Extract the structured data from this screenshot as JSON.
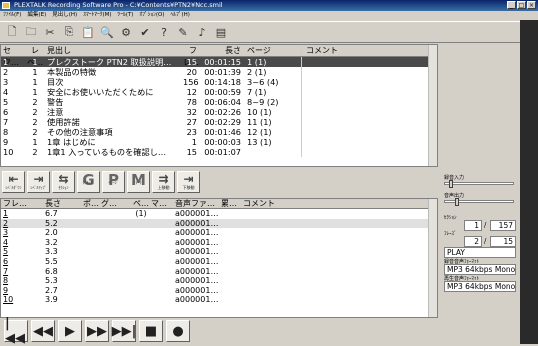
{
  "window": {
    "title": "PLEXTALK Recording Software Pro - C:¥Contents¥PTN2¥Ncc.smil"
  },
  "menu": [
    "ﾌｧｲﾙ(F)",
    "編集(E)",
    "見出し(H)",
    "ｽﾏｰﾄﾏｰｸ(M)",
    "ﾂｰﾙ(T)",
    "ｵﾌﾟｼｮﾝ(O)",
    "ﾍﾙﾌﾟ(H)"
  ],
  "toolbar_icons": [
    "new-file-icon",
    "open-folder-icon",
    "cut-icon",
    "copy-icon",
    "paste-icon",
    "search-icon",
    "properties-icon",
    "check-icon",
    "help-icon",
    "tool-icon",
    "sound-icon",
    "document-icon"
  ],
  "upper_headers": {
    "section": "セク…",
    "level": "レベ…",
    "heading": "見出し",
    "file": "フレ…",
    "length": "長さ",
    "page": "ページ",
    "comment": "コメント"
  },
  "upper_rows": [
    {
      "section": "1",
      "level": "1",
      "heading": "プレクストーク PTN2 取扱説明…",
      "file": "15",
      "length": "00:01:15",
      "page": "1 (1)"
    },
    {
      "section": "2",
      "level": "1",
      "heading": "本製品の特徴",
      "file": "20",
      "length": "00:01:39",
      "page": "2 (1)"
    },
    {
      "section": "3",
      "level": "1",
      "heading": "目次",
      "file": "156",
      "length": "00:14:18",
      "page": "3~6 (4)"
    },
    {
      "section": "4",
      "level": "1",
      "heading": "安全にお使いいただくために",
      "file": "12",
      "length": "00:00:59",
      "page": "7 (1)"
    },
    {
      "section": "5",
      "level": "2",
      "heading": "警告",
      "file": "78",
      "length": "00:06:04",
      "page": "8~9 (2)"
    },
    {
      "section": "6",
      "level": "2",
      "heading": "注意",
      "file": "32",
      "length": "00:02:26",
      "page": "10 (1)"
    },
    {
      "section": "7",
      "level": "2",
      "heading": "使用許諾",
      "file": "27",
      "length": "00:02:29",
      "page": "11 (1)"
    },
    {
      "section": "8",
      "level": "2",
      "heading": "その他の注意事項",
      "file": "23",
      "length": "00:01:46",
      "page": "12 (1)"
    },
    {
      "section": "9",
      "level": "1",
      "heading": "1章 はじめに",
      "file": "1",
      "length": "00:00:03",
      "page": "13 (1)"
    },
    {
      "section": "10",
      "level": "2",
      "heading": "1章1 入っているものを確認し…",
      "file": "15",
      "length": "00:01:07",
      "page": ""
    }
  ],
  "nav_buttons": [
    {
      "name": "prev-level-button",
      "symbol": "⇤",
      "label": "ﾚﾍﾞﾙﾀﾞｳﾝ"
    },
    {
      "name": "next-level-button",
      "symbol": "⇥",
      "label": "ﾚﾍﾞﾙｱｯﾌﾟ"
    },
    {
      "name": "section-button",
      "symbol": "⇆",
      "label": "ｾｸｼｮﾝ"
    },
    {
      "name": "group-button",
      "symbol": "G",
      "label": "ｸﾞﾙｰﾌﾟ"
    },
    {
      "name": "page-button",
      "symbol": "P",
      "label": "ﾍﾟｰｼﾞ"
    },
    {
      "name": "mark-button",
      "symbol": "M",
      "label": "ﾏｰｸ"
    },
    {
      "name": "move-up-button",
      "symbol": "⇉",
      "label": "上移動"
    },
    {
      "name": "move-down-button",
      "symbol": "⇥",
      "label": "下移動"
    }
  ],
  "lower_headers": {
    "phrase": "フレ…",
    "length": "長さ",
    "pos": "ポ…",
    "group": "グ…",
    "page": "ペ…",
    "mark": "マ…",
    "audio": "音声ファ…",
    "boundary": "累…",
    "comment": "コメント"
  },
  "lower_rows": [
    {
      "phrase": "1",
      "length": "6.7",
      "page": "(1)",
      "audio": "a000001…"
    },
    {
      "phrase": "2",
      "length": "5.2",
      "page": "",
      "audio": "a000001…"
    },
    {
      "phrase": "3",
      "length": "2.0",
      "page": "",
      "audio": "a000001…"
    },
    {
      "phrase": "4",
      "length": "3.2",
      "page": "",
      "audio": "a000001…"
    },
    {
      "phrase": "5",
      "length": "3.3",
      "page": "",
      "audio": "a000001…"
    },
    {
      "phrase": "6",
      "length": "5.5",
      "page": "",
      "audio": "a000001…"
    },
    {
      "phrase": "7",
      "length": "6.8",
      "page": "",
      "audio": "a000001…"
    },
    {
      "phrase": "8",
      "length": "5.3",
      "page": "",
      "audio": "a000001…"
    },
    {
      "phrase": "9",
      "length": "2.7",
      "page": "",
      "audio": "a000001…"
    },
    {
      "phrase": "10",
      "length": "3.9",
      "page": "",
      "audio": "a000001…"
    }
  ],
  "transport": [
    {
      "name": "first-button",
      "symbol": "|◀◀"
    },
    {
      "name": "rewind-button",
      "symbol": "◀◀"
    },
    {
      "name": "play-button",
      "symbol": "▶"
    },
    {
      "name": "fast-forward-button",
      "symbol": "▶▶"
    },
    {
      "name": "last-button",
      "symbol": "▶▶|"
    },
    {
      "name": "stop-button",
      "symbol": "■"
    },
    {
      "name": "record-button",
      "symbol": "●"
    }
  ],
  "right_panel": {
    "input_label": "録音入力",
    "output_label": "音声出力",
    "section_label": "ｾｸｼｮﾝ",
    "section_current": "1",
    "section_total": "157",
    "phrase_label": "ﾌﾚｰｽﾞ",
    "phrase_current": "2",
    "phrase_total": "15",
    "state": "PLAY",
    "rec_format_label": "録音音声ﾌｫｰﾏｯﾄ",
    "rec_format": "MP3 64kbps Mono",
    "play_format_label": "再生音声ﾌｫｰﾏｯﾄ",
    "play_format": "MP3 64kbps Mono"
  }
}
